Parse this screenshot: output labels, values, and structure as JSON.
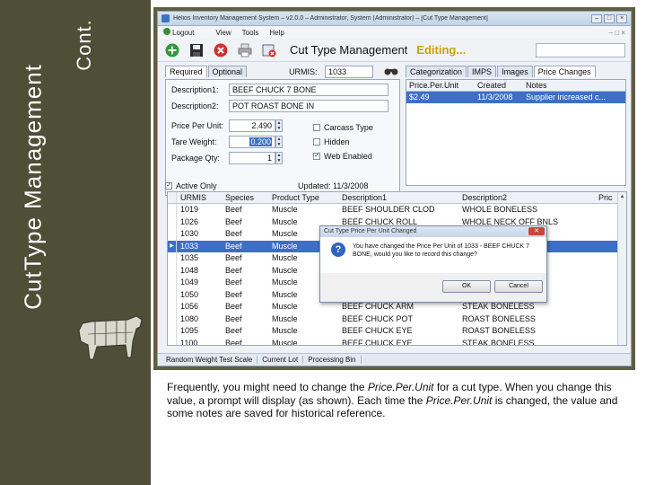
{
  "slide": {
    "title": "CutType Management",
    "cont": "Cont.",
    "caption_parts": [
      "Frequently, you might need to change the ",
      "Price.Per.Unit",
      " for a cut type. When you change this value, a prompt will display (as shown). Each time the ",
      "Price.Per.Unit",
      " is changed, the value and some notes are saved for historical reference."
    ]
  },
  "window": {
    "title": "Helios Inventory Management System – v2.0.0 – Administrator, System (Administrator) – [Cut Type Management]",
    "menu": [
      "Logout",
      "View",
      "Tools",
      "Help"
    ],
    "form_title": "Cut Type Management",
    "status": "Editing..."
  },
  "left_tabs": [
    "Required",
    "Optional"
  ],
  "urmis": {
    "label": "URMIS:",
    "value": "1033"
  },
  "fields": {
    "desc1_label": "Description1:",
    "desc1_value": "BEEF CHUCK 7 BONE",
    "desc2_label": "Description2:",
    "desc2_value": "POT ROAST BONE IN",
    "ppu_label": "Price Per Unit:",
    "ppu_value": "2.490",
    "tare_label": "Tare Weight:",
    "tare_value": "0.200",
    "pkg_label": "Package Qty:",
    "pkg_value": "1"
  },
  "checks": {
    "carcass_type": {
      "label": "Carcass Type",
      "checked": false
    },
    "hidden": {
      "label": "Hidden",
      "checked": false
    },
    "web_enabled": {
      "label": "Web Enabled",
      "checked": true
    },
    "active_only": {
      "label": "Active Only",
      "checked": true
    }
  },
  "updated": {
    "label": "Updated:",
    "value": "11/3/2008"
  },
  "right_tabs": [
    "Categorization",
    "IMPS",
    "Images",
    "Price Changes"
  ],
  "price_changes": {
    "columns": [
      "Price.Per.Unit",
      "Created",
      "Notes"
    ],
    "rows": [
      {
        "price": "$2.49",
        "created": "11/3/2008",
        "notes": "Supplier increased c..."
      }
    ]
  },
  "grid": {
    "columns": [
      "URMIS",
      "Species",
      "Product Type",
      "Description1",
      "Description2",
      "Pric"
    ],
    "rows": [
      {
        "urmis": "1019",
        "species": "Beef",
        "ptype": "Muscle",
        "d1": "BEEF SHOULDER CLOD",
        "d2": "WHOLE BONELESS",
        "selected": false
      },
      {
        "urmis": "1026",
        "species": "Beef",
        "ptype": "Muscle",
        "d1": "BEEF CHUCK ROLL",
        "d2": "WHOLE NECK OFF BNLS",
        "selected": false
      },
      {
        "urmis": "1030",
        "species": "Beef",
        "ptype": "Muscle",
        "d1": "",
        "d2": "lod Tender)",
        "selected": false
      },
      {
        "urmis": "1033",
        "species": "Beef",
        "ptype": "Muscle",
        "d1": "",
        "d2": "",
        "selected": true
      },
      {
        "urmis": "1035",
        "species": "Beef",
        "ptype": "Muscle",
        "d1": "",
        "d2": "",
        "selected": false
      },
      {
        "urmis": "1048",
        "species": "Beef",
        "ptype": "Muscle",
        "d1": "",
        "d2": "N",
        "selected": false
      },
      {
        "urmis": "1049",
        "species": "Beef",
        "ptype": "Muscle",
        "d1": "",
        "d2": "ESS",
        "selected": false
      },
      {
        "urmis": "1050",
        "species": "Beef",
        "ptype": "Muscle",
        "d1": "",
        "d2": "",
        "selected": false
      },
      {
        "urmis": "1056",
        "species": "Beef",
        "ptype": "Muscle",
        "d1": "BEEF CHUCK ARM",
        "d2": "STEAK BONELESS",
        "selected": false
      },
      {
        "urmis": "1080",
        "species": "Beef",
        "ptype": "Muscle",
        "d1": "BEEF CHUCK POT",
        "d2": "ROAST BONELESS",
        "selected": false
      },
      {
        "urmis": "1095",
        "species": "Beef",
        "ptype": "Muscle",
        "d1": "BEEF CHUCK EYE",
        "d2": "ROAST BONELESS",
        "selected": false
      },
      {
        "urmis": "1100",
        "species": "Beef",
        "ptype": "Muscle",
        "d1": "BEEF CHUCK EYE",
        "d2": "STEAK BONELESS",
        "selected": false
      }
    ]
  },
  "dialog": {
    "title": "Cut Type Price Per Unit Changed",
    "message": "You have changed the Price Per Unit of 1033 - BEEF CHUCK 7 BONE, would you like to record this change?",
    "ok": "OK",
    "cancel": "Cancel"
  },
  "statusbar": [
    "Random Weight Test Scale",
    "Current Lot",
    "Processing Bin"
  ],
  "colors": {
    "sidebar": "#4f4e36",
    "selection": "#3d6fc7",
    "editing": "#c8a400"
  }
}
